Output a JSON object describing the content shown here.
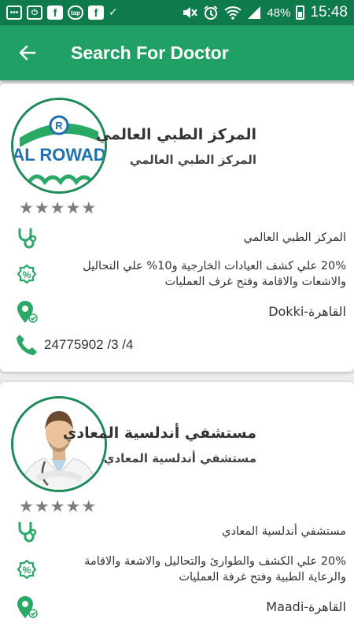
{
  "status_bar": {
    "battery": "48%",
    "time": "15:48",
    "icons": [
      "chat-dots-icon",
      "power-icon",
      "facebook-icon",
      "tap-icon",
      "facebook-icon",
      "check-icon",
      "mute-icon",
      "alarm-icon",
      "wifi-icon",
      "signal-icon",
      "battery-charging-icon"
    ]
  },
  "header": {
    "title": "Search For Doctor"
  },
  "colors": {
    "status_bar": "#0f7a4b",
    "app_bar": "#20a064",
    "icon_green": "#2aa866"
  },
  "cards": [
    {
      "logo_text": "AL ROWAD",
      "name": "المركز الطبي العالمي",
      "subtitle": "المركز الطبي العالمي",
      "rating": 0,
      "specialty": "المركز الطبي العالمي",
      "offer": "20% علي كشف العيادات الخارجية و10% علي التحاليل والاشعات والاقامة وفتح غرف العمليات",
      "address": "القاهرة-Dokki",
      "phone": "24775902 /3 /4"
    },
    {
      "name": "مستشفي أندلسية المعادي",
      "subtitle": "مستشفي أندلسية المعادي",
      "rating": 0,
      "specialty": "مستشفي أندلسية المعادي",
      "offer": "20% علي الكشف والطوارئ والتحاليل والاشعة والاقامة والرعاية الطبية وفتح غرفة العمليات",
      "address": "القاهرة-Maadi"
    }
  ]
}
